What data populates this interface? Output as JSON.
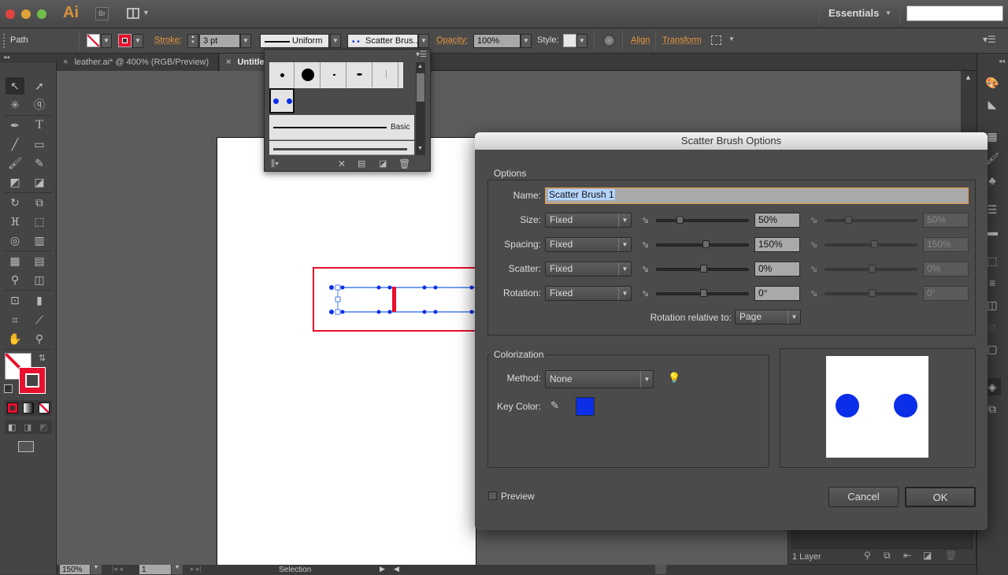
{
  "titlebar": {
    "app_logo": "Ai",
    "bridge_label": "Br",
    "workspace": "Essentials",
    "search_value": ""
  },
  "control_bar": {
    "selection_type": "Path",
    "stroke_label": "Stroke:",
    "stroke_weight": "3 pt",
    "profile": "Uniform",
    "brush": "Scatter Brus...",
    "opacity_label": "Opacity:",
    "opacity": "100%",
    "style_label": "Style:",
    "align_label": "Align",
    "transform_label": "Transform",
    "colors": {
      "stroke": "#e8102e",
      "accent": "#e8973f"
    }
  },
  "tabs": [
    {
      "label": "leather.ai* @ 400% (RGB/Preview)",
      "active": false
    },
    {
      "label": "Untitle",
      "active": true
    }
  ],
  "brush_panel": {
    "items": [
      "dot-small",
      "dot-large",
      "dash-tiny",
      "blob",
      "line-thin",
      "scatter-brush-1"
    ],
    "basic_label": "Basic",
    "selected": "scatter-brush-1"
  },
  "dialog": {
    "title": "Scatter Brush Options",
    "options_group": "Options",
    "name_label": "Name:",
    "name_value": "Scatter Brush 1",
    "rows": [
      {
        "label": "Size:",
        "mode": "Fixed",
        "value": "50%",
        "value2": "50%",
        "pos": 0.23
      },
      {
        "label": "Spacing:",
        "mode": "Fixed",
        "value": "150%",
        "value2": "150%",
        "pos": 0.53
      },
      {
        "label": "Scatter:",
        "mode": "Fixed",
        "value": "0%",
        "value2": "0%",
        "pos": 0.5
      },
      {
        "label": "Rotation:",
        "mode": "Fixed",
        "value": "0°",
        "value2": "0°",
        "pos": 0.5
      }
    ],
    "rotation_relative_label": "Rotation relative to:",
    "rotation_relative_value": "Page",
    "colorization_group": "Colorization",
    "method_label": "Method:",
    "method_value": "None",
    "key_color_label": "Key Color:",
    "key_color": "#0b2fe8",
    "preview_label": "Preview",
    "preview_checked": false,
    "cancel_label": "Cancel",
    "ok_label": "OK"
  },
  "layers": {
    "count_label": "1 Layer"
  },
  "status_bar": {
    "zoom": "150%",
    "artboard": "1",
    "tool": "Selection"
  }
}
